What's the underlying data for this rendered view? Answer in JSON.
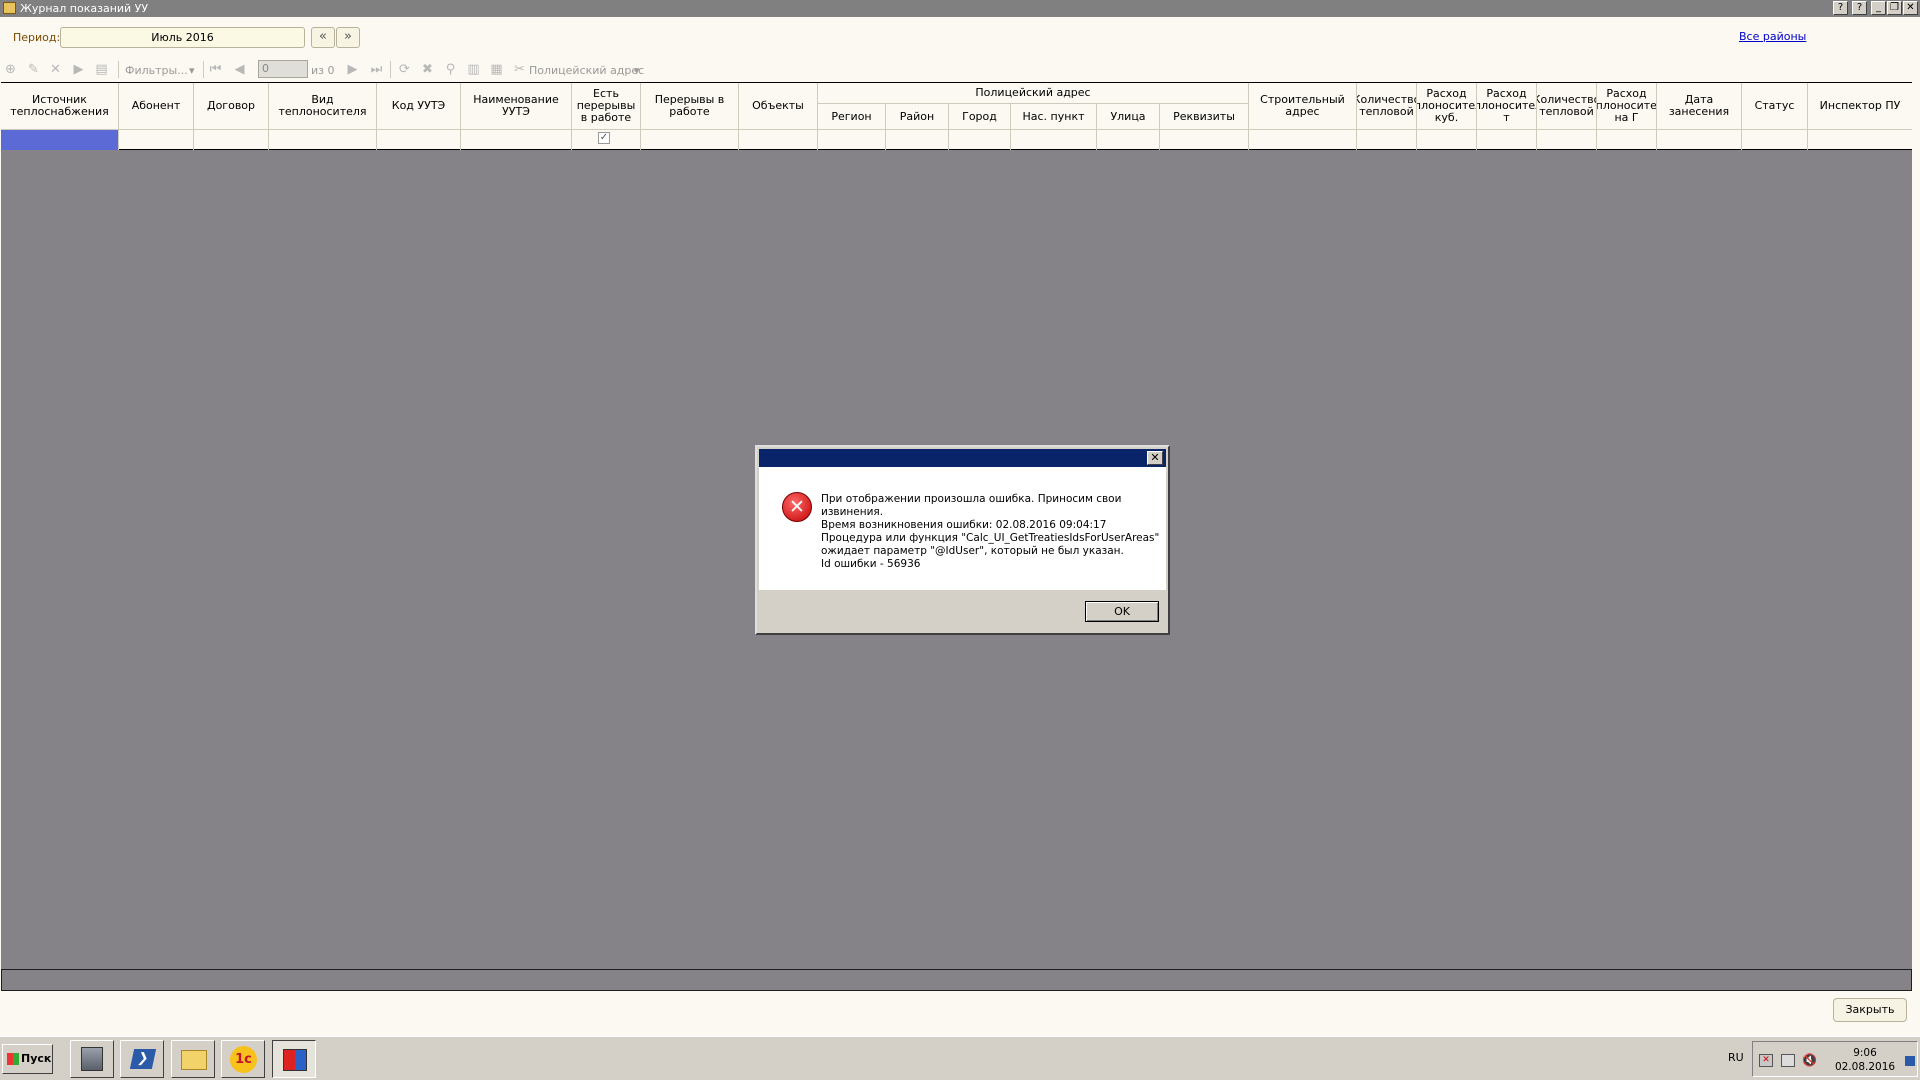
{
  "window": {
    "title": "Журнал показаний УУ",
    "min": "_",
    "restore": "❐",
    "close": "✕",
    "help": "?"
  },
  "period": {
    "label": "Период:",
    "value": "Июль 2016",
    "prev": "«",
    "next": "»"
  },
  "all_districts_link": "Все районы",
  "toolbar": {
    "filters": "Фильтры...",
    "page_value": "0",
    "page_of": "из 0",
    "police_address": "Полицейский адрес"
  },
  "grid": {
    "columns": [
      "Источник теплоснабжения",
      "Абонент",
      "Договор",
      "Вид теплоносителя",
      "Код УУТЭ",
      "Наименование УУТЭ",
      "Есть перерывы в работе",
      "Перерывы в работе",
      "Объекты",
      "Полицейский адрес",
      "Регион",
      "Район",
      "Город",
      "Нас. пункт",
      "Улица",
      "Реквизиты",
      "Строительный адрес",
      "Количество тепловой",
      "Расход теплоносителя, куб.",
      "Расход теплоносителя, т",
      "Количество тепловой",
      "Расход теплоносителя на Г",
      "Дата занесения",
      "Статус",
      "Инспектор ПУ"
    ],
    "row_has_interruptions_checked": true
  },
  "dialog": {
    "lines": [
      "При отображении произошла ошибка. Приносим свои",
      "извинения.",
      "Время возникновения ошибки: 02.08.2016 09:04:17",
      "Процедура или функция \"Calc_UI_GetTreatiesIdsForUserAreas\"",
      "ожидает параметр \"@IdUser\", который не был указан.",
      "Id ошибки - 56936"
    ],
    "ok": "OK",
    "close": "✕"
  },
  "close_button": "Закрыть",
  "taskbar": {
    "start": "Пуск",
    "apps": [
      "server-manager",
      "powershell",
      "explorer",
      "1c",
      "active-app"
    ],
    "lang": "RU",
    "time": "9:06",
    "date": "02.08.2016"
  }
}
